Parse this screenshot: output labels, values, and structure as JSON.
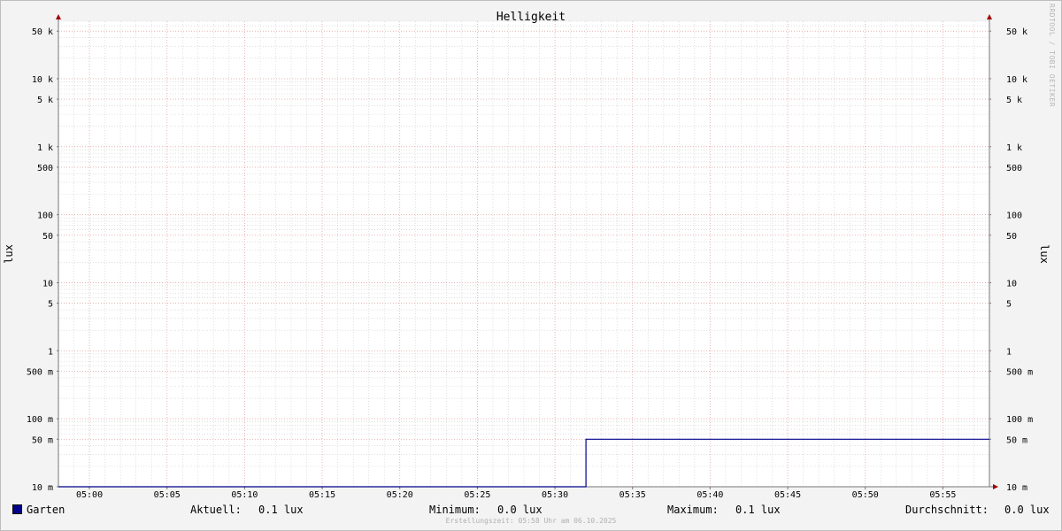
{
  "chart_data": {
    "type": "line",
    "title": "Helligkeit",
    "ylabel": "lux",
    "yscale": "log",
    "ylim": [
      0.01,
      70000
    ],
    "xlim": [
      "04:58",
      "05:58"
    ],
    "grid": true,
    "y_ticks": [
      {
        "value": 50000,
        "label": "50 k"
      },
      {
        "value": 10000,
        "label": "10 k"
      },
      {
        "value": 5000,
        "label": "5 k"
      },
      {
        "value": 1000,
        "label": "1 k"
      },
      {
        "value": 500,
        "label": "500"
      },
      {
        "value": 100,
        "label": "100"
      },
      {
        "value": 50,
        "label": "50"
      },
      {
        "value": 10,
        "label": "10"
      },
      {
        "value": 5,
        "label": "5"
      },
      {
        "value": 1,
        "label": "1"
      },
      {
        "value": 0.5,
        "label": "500 m"
      },
      {
        "value": 0.1,
        "label": "100 m"
      },
      {
        "value": 0.05,
        "label": "50 m"
      },
      {
        "value": 0.01,
        "label": "10 m"
      }
    ],
    "x_ticks": [
      "05:00",
      "05:05",
      "05:10",
      "05:15",
      "05:20",
      "05:25",
      "05:30",
      "05:35",
      "05:40",
      "05:45",
      "05:50",
      "05:55"
    ],
    "series": [
      {
        "name": "Garten",
        "color": "#00008b",
        "points": [
          {
            "x": "04:58",
            "y": 0.01
          },
          {
            "x": "05:32",
            "y": 0.01
          },
          {
            "x": "05:32",
            "y": 0.05
          },
          {
            "x": "05:58",
            "y": 0.05
          }
        ]
      }
    ]
  },
  "legend": {
    "series_name": "Garten",
    "current_label": "Aktuell:",
    "current_value": "0.1 lux",
    "min_label": "Minimum:",
    "min_value": "0.0 lux",
    "max_label": "Maximum:",
    "max_value": "0.1 lux",
    "avg_label": "Durchschnitt:",
    "avg_value": "0.0 lux"
  },
  "footer": "Erstellungszeit: 05:58 Uhr am 06.10.2025",
  "watermark": "RRDTOOL / TOBI OETIKER",
  "colors": {
    "major_grid": "#e8a0a0",
    "minor_grid": "#cccccc",
    "axis": "#777777",
    "arrow": "#a00000",
    "series": "#00008b"
  }
}
